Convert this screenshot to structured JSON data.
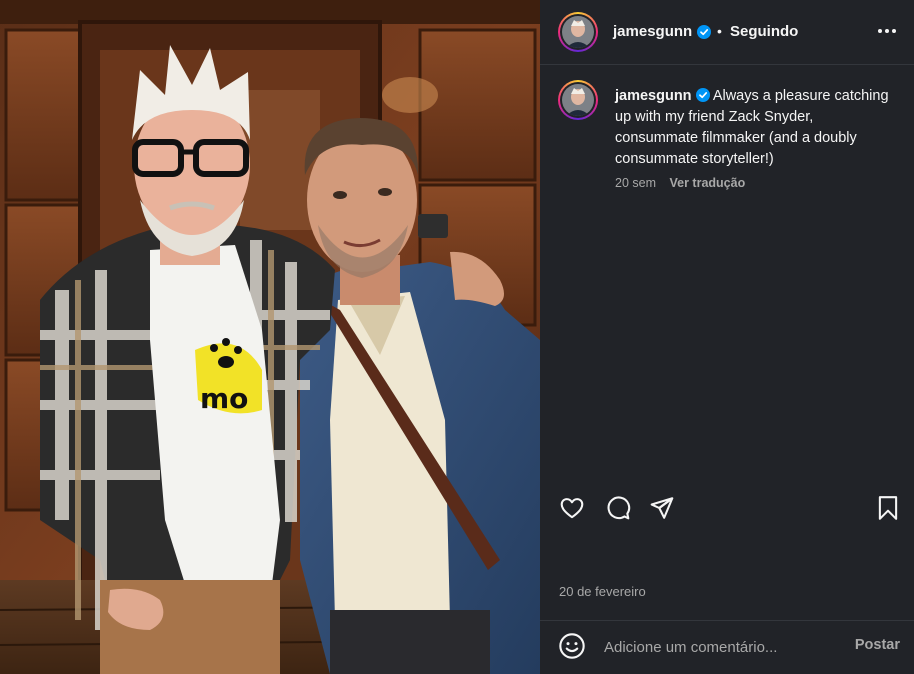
{
  "header": {
    "username": "jamesgunn",
    "separator": "•",
    "follow_status": "Seguindo",
    "more_icon": "more-horizontal-icon"
  },
  "caption": {
    "username": "jamesgunn",
    "text": "Always a pleasure catching up with my friend Zack Snyder, consummate filmmaker (and a doubly consummate storyteller!)",
    "time_ago": "20 sem",
    "translate_label": "Ver tradução"
  },
  "actions": {
    "like_icon": "heart-icon",
    "comment_icon": "comment-icon",
    "share_icon": "share-icon",
    "save_icon": "bookmark-icon"
  },
  "post_date": "20 de fevereiro",
  "comment": {
    "placeholder": "Adicione um comentário...",
    "post_label": "Postar",
    "emoji_icon": "emoji-icon"
  },
  "colors": {
    "panel_bg": "#212328",
    "verified_badge": "#0095f6",
    "muted_text": "#a8a8a8"
  }
}
